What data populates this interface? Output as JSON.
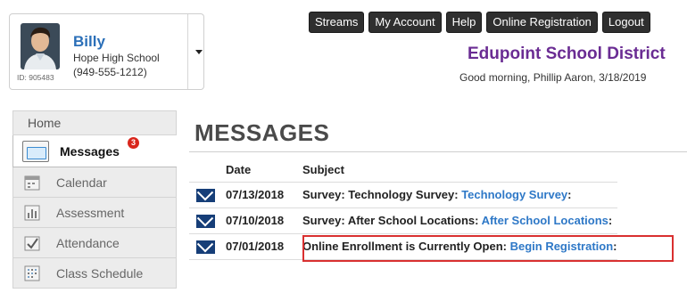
{
  "student": {
    "name": "Billy",
    "school": "Hope High School",
    "phone": "(949-555-1212)",
    "id_label": "ID: 905483"
  },
  "topnav": {
    "buttons": [
      "Streams",
      "My Account",
      "Help",
      "Online Registration",
      "Logout"
    ]
  },
  "header": {
    "district": "Edupoint School District",
    "greeting": "Good morning, Phillip Aaron, 3/18/2019"
  },
  "sidebar": {
    "items": [
      {
        "label": "Home",
        "icon": "home"
      },
      {
        "label": "Messages",
        "icon": "envelope-icon",
        "badge": "3",
        "active": true
      },
      {
        "label": "Calendar",
        "icon": "calendar-icon"
      },
      {
        "label": "Assessment",
        "icon": "bar-chart-icon"
      },
      {
        "label": "Attendance",
        "icon": "checkbox-icon"
      },
      {
        "label": "Class Schedule",
        "icon": "schedule-icon"
      }
    ]
  },
  "main": {
    "title": "MESSAGES",
    "columns": [
      "Date",
      "Subject"
    ],
    "rows": [
      {
        "date": "07/13/2018",
        "subject": "Survey: Technology Survey: ",
        "link": "Technology Survey",
        "suffix": ":"
      },
      {
        "date": "07/10/2018",
        "subject": "Survey: After School Locations: ",
        "link": "After School Locations",
        "suffix": ":"
      },
      {
        "date": "07/01/2018",
        "subject": "Online Enrollment is Currently Open: ",
        "link": "Begin Registration",
        "suffix": ":"
      }
    ]
  },
  "colors": {
    "accent_blue": "#2b6fb8",
    "district_purple": "#6a2c93",
    "envelope_navy": "#163e78",
    "highlight_red": "#d93030",
    "badge_red": "#d9261c"
  }
}
